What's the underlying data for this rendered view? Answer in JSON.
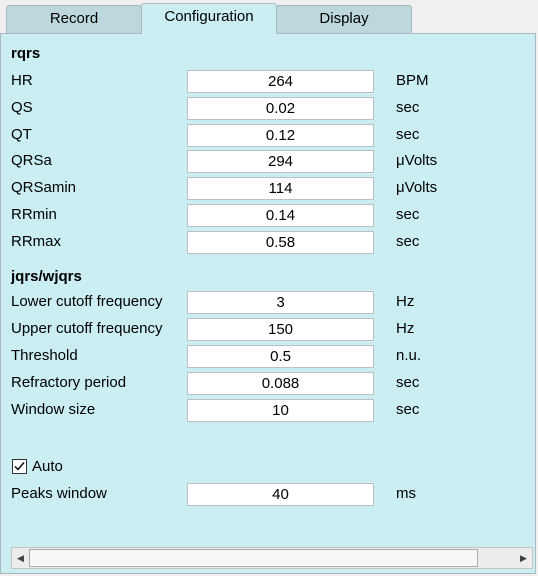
{
  "tabs": [
    {
      "label": "Record",
      "active": false
    },
    {
      "label": "Configuration",
      "active": true
    },
    {
      "label": "Display",
      "active": false
    }
  ],
  "rqrs": {
    "title": "rqrs",
    "rows": [
      {
        "label": "HR",
        "value": "264",
        "unit": "BPM"
      },
      {
        "label": "QS",
        "value": "0.02",
        "unit": "sec"
      },
      {
        "label": "QT",
        "value": "0.12",
        "unit": "sec"
      },
      {
        "label": "QRSa",
        "value": "294",
        "unit": "μVolts"
      },
      {
        "label": "QRSamin",
        "value": "114",
        "unit": "μVolts"
      },
      {
        "label": "RRmin",
        "value": "0.14",
        "unit": "sec"
      },
      {
        "label": "RRmax",
        "value": "0.58",
        "unit": "sec"
      }
    ]
  },
  "jqrs": {
    "title": "jqrs/wjqrs",
    "rows": [
      {
        "label": "Lower cutoff frequency",
        "value": "3",
        "unit": "Hz"
      },
      {
        "label": "Upper cutoff frequency",
        "value": "150",
        "unit": "Hz"
      },
      {
        "label": "Threshold",
        "value": "0.5",
        "unit": "n.u."
      },
      {
        "label": "Refractory period",
        "value": "0.088",
        "unit": "sec"
      },
      {
        "label": "Window size",
        "value": "10",
        "unit": "sec"
      }
    ]
  },
  "auto": {
    "label": "Auto",
    "checked": true
  },
  "peaks": {
    "label": "Peaks window",
    "value": "40",
    "unit": "ms"
  },
  "scrollbar": {
    "left_arrow_icon": "arrow-left-icon",
    "right_arrow_icon": "arrow-right-icon"
  },
  "colors": {
    "panel_bg": "#cbeef2",
    "tab_bg": "#bcd8dc",
    "window_bg": "#f0f0f0"
  }
}
